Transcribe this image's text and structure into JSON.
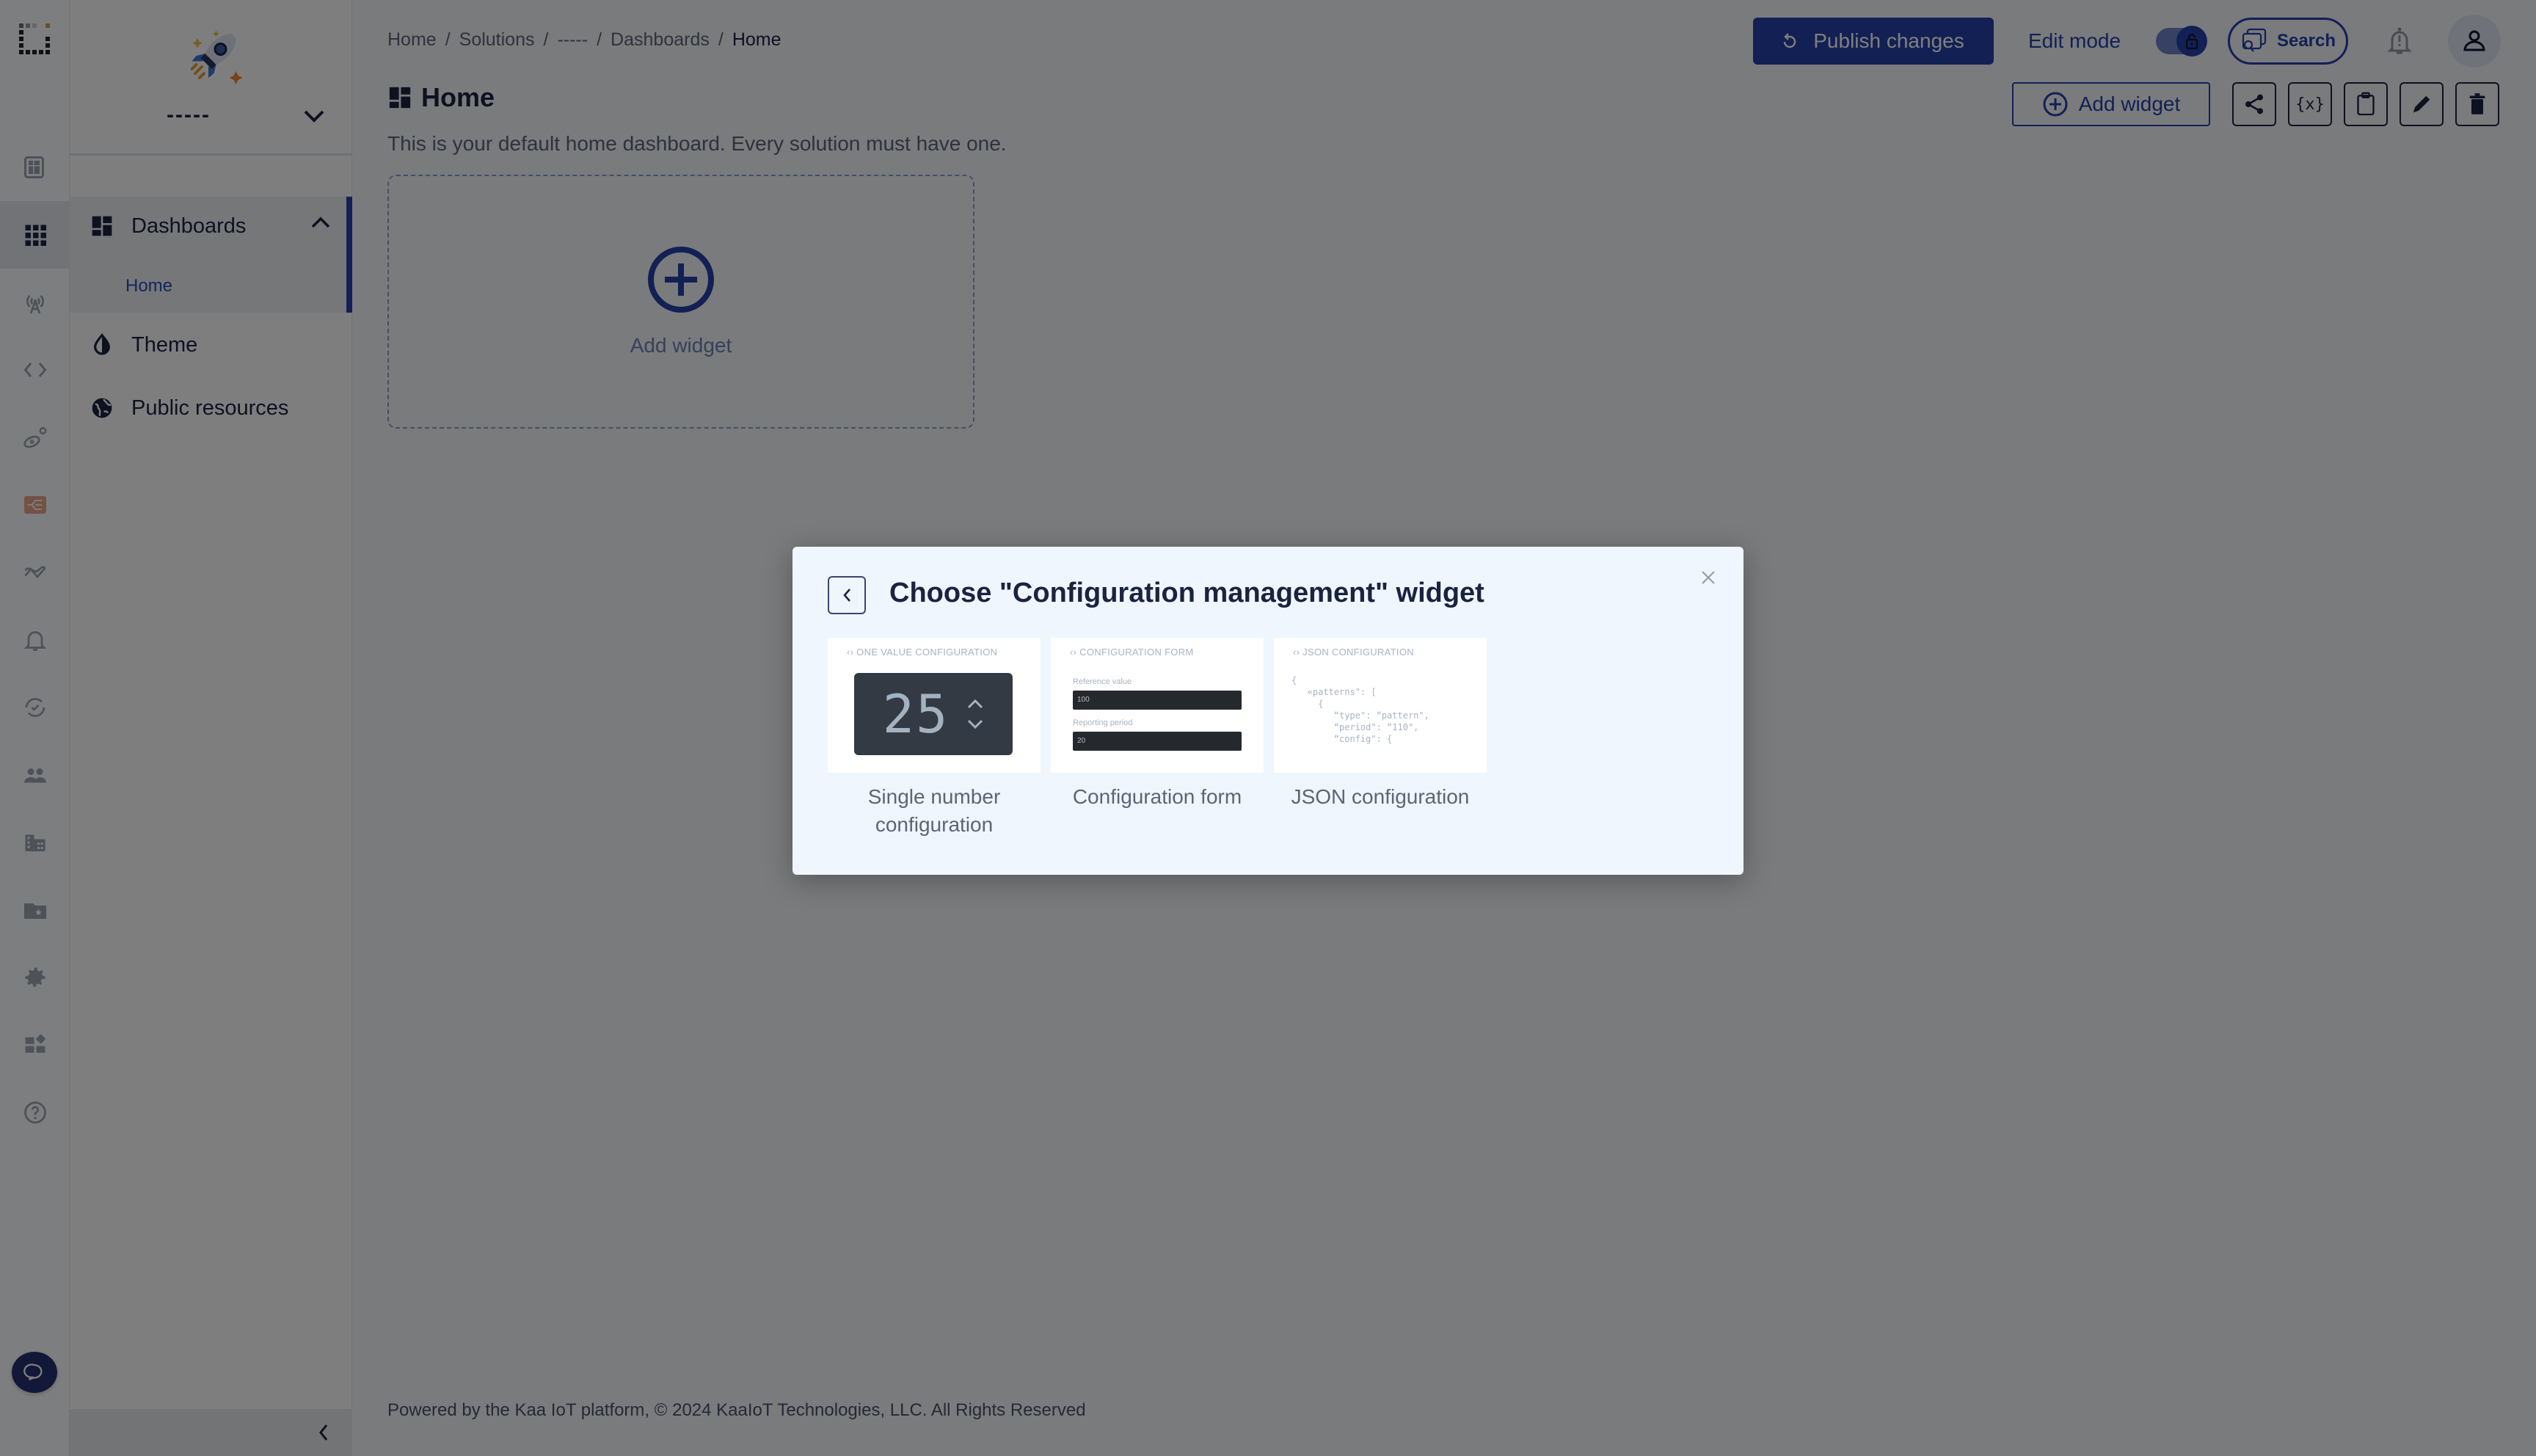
{
  "sidebar": {
    "solution_name": "-----",
    "rail_icons": [
      "solutions-icon",
      "dashboards-grid-icon",
      "devices-antenna-icon",
      "code-icon",
      "ota-icon",
      "rule-engine-icon",
      "analytics-icon",
      "alerts-bell-icon",
      "sync-check-icon",
      "users-icon",
      "tenants-building-icon",
      "files-folder-icon",
      "settings-gear-icon",
      "widgets-icon",
      "help-icon"
    ],
    "nav": {
      "dashboards_label": "Dashboards",
      "home_label": "Home",
      "theme_label": "Theme",
      "public_resources_label": "Public resources"
    }
  },
  "header": {
    "breadcrumb": [
      "Home",
      "Solutions",
      "-----",
      "Dashboards",
      "Home"
    ],
    "publish_label": "Publish changes",
    "edit_mode_label": "Edit mode",
    "edit_mode_on": true,
    "search_label": "Search"
  },
  "page": {
    "title": "Home",
    "description": "This is your default home dashboard. Every solution must have one.",
    "add_widget_label": "Add widget",
    "slot_add_label": "Add widget",
    "toolbar_icons": [
      "share-icon",
      "variables-icon",
      "clipboard-icon",
      "edit-icon",
      "delete-icon"
    ]
  },
  "footer": {
    "text": "Powered by the Kaa IoT platform, © 2024 KaaIoT Technologies, LLC. All Rights Reserved"
  },
  "modal": {
    "title": "Choose \"Configuration management\" widget",
    "cards": [
      {
        "header": "ONE VALUE CONFIGURATION",
        "value": "25",
        "caption": "Single number configuration"
      },
      {
        "header": "CONFIGURATION FORM",
        "fields": [
          {
            "label": "Reference value",
            "value": "100"
          },
          {
            "label": "Reporting period",
            "value": "20"
          }
        ],
        "caption": "Configuration form"
      },
      {
        "header": "JSON CONFIGURATION",
        "code": "{\n   «patterns\": [\n     {\n        “type\": “pattern\",\n        “period\": “110\",\n        “config\": {",
        "caption": "JSON configuration"
      }
    ]
  },
  "colors": {
    "accent": "#2540a8",
    "text": "#1a2340",
    "modal_bg": "#f0f6fd"
  }
}
